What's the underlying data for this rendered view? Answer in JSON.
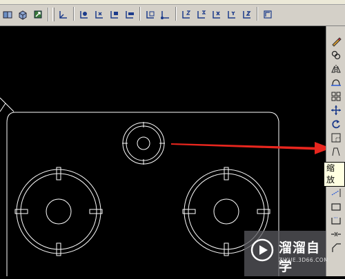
{
  "toolbar": {
    "left_icons": [
      "view-3d-icon",
      "solid-box-icon",
      "rotate-view-icon"
    ],
    "dimension_icons": [
      "ucs-icon",
      "ucs-world-icon",
      "ucs-previous-icon",
      "ucs-face-icon",
      "ucs-object-icon",
      "ucs-view-icon",
      "ucs-origin-icon",
      "ucs-zaxis-icon",
      "ucs-3point-icon",
      "ucs-x-icon",
      "ucs-y-icon",
      "ucs-z-icon",
      "ucs-apply-icon"
    ]
  },
  "right_toolbar": {
    "icons": [
      "erase-icon",
      "copy-icon",
      "mirror-icon",
      "offset-icon",
      "array-icon",
      "move-icon",
      "rotate-icon",
      "scale-icon",
      "stretch-icon",
      "trim-icon",
      "extend-icon",
      "break-icon",
      "join-icon",
      "chamfer-icon",
      "fillet-icon"
    ]
  },
  "tooltip": {
    "text": "缩放"
  },
  "watermark": {
    "title": "溜溜自学",
    "url": "ZIXUE.3D66.COM"
  },
  "annotation": {
    "arrow_color": "#e8261e"
  }
}
